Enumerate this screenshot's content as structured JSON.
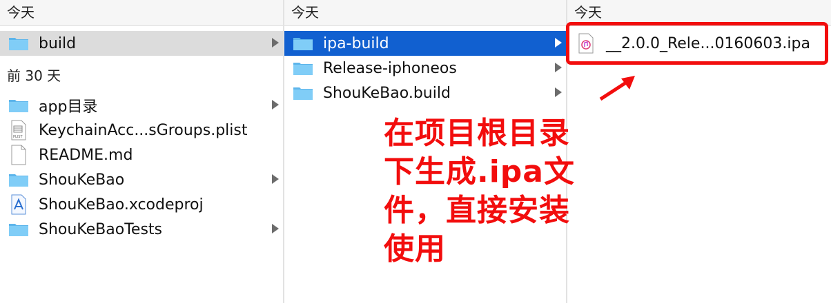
{
  "column1": {
    "section_today": "今天",
    "item_build": "build",
    "section_30days": "前 30 天",
    "items": [
      {
        "label": "app目录",
        "icon": "folder-icon",
        "has_arrow": true
      },
      {
        "label": "KeychainAcc...sGroups.plist",
        "icon": "plist-file-icon",
        "has_arrow": false
      },
      {
        "label": "README.md",
        "icon": "document-icon",
        "has_arrow": false
      },
      {
        "label": "ShouKeBao",
        "icon": "folder-icon",
        "has_arrow": true
      },
      {
        "label": "ShouKeBao.xcodeproj",
        "icon": "xcodeproj-icon",
        "has_arrow": false
      },
      {
        "label": "ShouKeBaoTests",
        "icon": "folder-icon",
        "has_arrow": true
      }
    ]
  },
  "column2": {
    "section_today": "今天",
    "items": [
      {
        "label": "ipa-build",
        "selected": true
      },
      {
        "label": "Release-iphoneos",
        "selected": false
      },
      {
        "label": "ShouKeBao.build",
        "selected": false
      }
    ]
  },
  "column3": {
    "section_today": "今天",
    "file": "__2.0.0_Rele...0160603.ipa"
  },
  "annotation": {
    "lines": [
      "在项目根目录",
      "下生成.ipa文",
      "件，直接安装",
      "使用"
    ],
    "color": "#f20d0d"
  },
  "colors": {
    "selection_blue": "#1160d0",
    "selection_gray": "#dcdcdc",
    "folder_blue": "#6cc4f4"
  }
}
